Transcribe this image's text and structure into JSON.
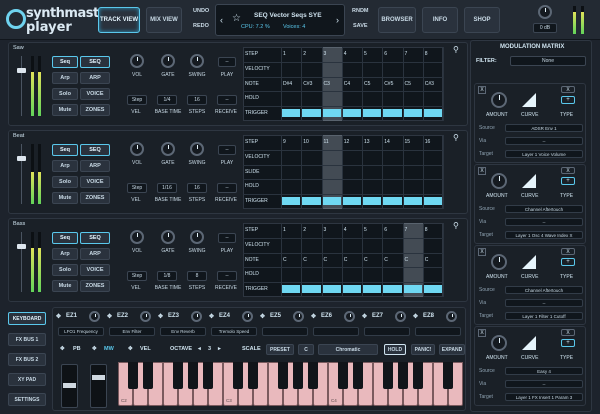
{
  "logo": {
    "line1": "synthmaster",
    "line2": "player"
  },
  "topbar": {
    "track_view": "TRACK VIEW",
    "mix_view": "MIX VIEW",
    "undo": "UNDO",
    "redo": "REDO",
    "preset_name": "SEQ Vector Seqs SYE",
    "cpu": "CPU: 7.2 %",
    "voices": "Voices: 4",
    "rndm": "RNDM",
    "save": "SAVE",
    "browser": "BROWSER",
    "info": "INFO",
    "shop": "SHOP",
    "volume": "0 dB"
  },
  "tracks": [
    {
      "name": "Saw",
      "seq_small": "Seq",
      "seq_big": "SEQ",
      "arp_small": "Arp",
      "arp_big": "ARP",
      "solo": "Solo",
      "voice": "VOICE",
      "mute": "Mute",
      "zones": "ZONES",
      "vol": "VOL",
      "gate": "GATE",
      "swing": "SWING",
      "play": "PLAY",
      "step_mode": "Step",
      "base_time_val": "1/4",
      "steps_val": "16",
      "receive_val": "--",
      "vel": "VEL",
      "base_time": "BASE TIME",
      "steps": "STEPS",
      "receive": "RECEIVE",
      "play_val": "--",
      "rows": [
        "STEP",
        "VELOCITY",
        "NOTE",
        "HOLD",
        "TRIGGER"
      ],
      "steps_header": [
        "1",
        "2",
        "3",
        "4",
        "5",
        "6",
        "7",
        "8"
      ],
      "notes": [
        "D#4",
        "C#3",
        "C3",
        "C4",
        "C5",
        "C#5",
        "C5",
        "C#3"
      ]
    },
    {
      "name": "Beat",
      "seq_small": "Seq",
      "seq_big": "SEQ",
      "arp_small": "Arp",
      "arp_big": "ARP",
      "solo": "Solo",
      "voice": "VOICE",
      "mute": "Mute",
      "zones": "ZONES",
      "vol": "VOL",
      "gate": "GATE",
      "swing": "SWING",
      "play": "PLAY",
      "step_mode": "Step",
      "base_time_val": "1/16",
      "steps_val": "16",
      "receive_val": "--",
      "vel": "VEL",
      "base_time": "BASE TIME",
      "steps": "STEPS",
      "receive": "RECEIVE",
      "play_val": "--",
      "rows": [
        "STEP",
        "VELOCITY",
        "SLIDE",
        "HOLD",
        "TRIGGER"
      ],
      "steps_header": [
        "9",
        "10",
        "11",
        "12",
        "13",
        "14",
        "15",
        "16"
      ],
      "notes": []
    },
    {
      "name": "Bass",
      "seq_small": "Seq",
      "seq_big": "SEQ",
      "arp_small": "Arp",
      "arp_big": "ARP",
      "solo": "Solo",
      "voice": "VOICE",
      "mute": "Mute",
      "zones": "ZONES",
      "vol": "VOL",
      "gate": "GATE",
      "swing": "SWING",
      "play": "PLAY",
      "step_mode": "Step",
      "base_time_val": "1/8",
      "steps_val": "8",
      "receive_val": "--",
      "vel": "VEL",
      "base_time": "BASE TIME",
      "steps": "STEPS",
      "receive": "RECEIVE",
      "play_val": "--",
      "rows": [
        "STEP",
        "VELOCITY",
        "NOTE",
        "HOLD",
        "TRIGGER"
      ],
      "steps_header": [
        "1",
        "2",
        "3",
        "4",
        "5",
        "6",
        "7",
        "8"
      ],
      "notes": [
        "C",
        "C",
        "C",
        "C",
        "C",
        "C",
        "C",
        "C"
      ]
    }
  ],
  "modmatrix": {
    "title": "MODULATION MATRIX",
    "filter_label": "FILTER:",
    "filter_val": "None",
    "amount": "AMOUNT",
    "curve": "CURVE",
    "type": "TYPE",
    "source_lbl": "Source",
    "via_lbl": "Via",
    "target_lbl": "Target",
    "slots": [
      {
        "source": "ADSR Env 1",
        "via": "--",
        "target": "Layer 1 Voice Volume"
      },
      {
        "source": "Channel Aftertouch",
        "via": "--",
        "target": "Layer 1 Osc 4 Wave Index X"
      },
      {
        "source": "Channel Aftertouch",
        "via": "--",
        "target": "Layer 1 Filter 1 Cutoff"
      },
      {
        "source": "Easy 4",
        "via": "--",
        "target": "Layer 1 FX Insert 1 Param 3"
      }
    ]
  },
  "easy": {
    "labels": [
      "EZ1",
      "EZ2",
      "EZ3",
      "EZ4",
      "EZ5",
      "EZ6",
      "EZ7",
      "EZ8"
    ],
    "macros": [
      "LFO1 Frequency",
      "Env Filter",
      "Env Reverb",
      "Tremolo Speed",
      "",
      "",
      "",
      ""
    ]
  },
  "side": {
    "keyboard": "KEYBOARD",
    "fxbus1": "FX BUS 1",
    "fxbus2": "FX BUS 2",
    "xypad": "XY PAD",
    "settings": "SETTINGS"
  },
  "kb": {
    "pb": "PB",
    "mw": "MW",
    "vel": "VEL",
    "octave": "OCTAVE",
    "octave_val": "3",
    "scale": "SCALE",
    "preset": "PRESET",
    "key": "C",
    "mode": "Chromatic",
    "hold": "HOLD",
    "panic": "PANIC!",
    "expand": "EXPAND",
    "c2": "C2",
    "c3": "C3",
    "c4": "C4"
  }
}
